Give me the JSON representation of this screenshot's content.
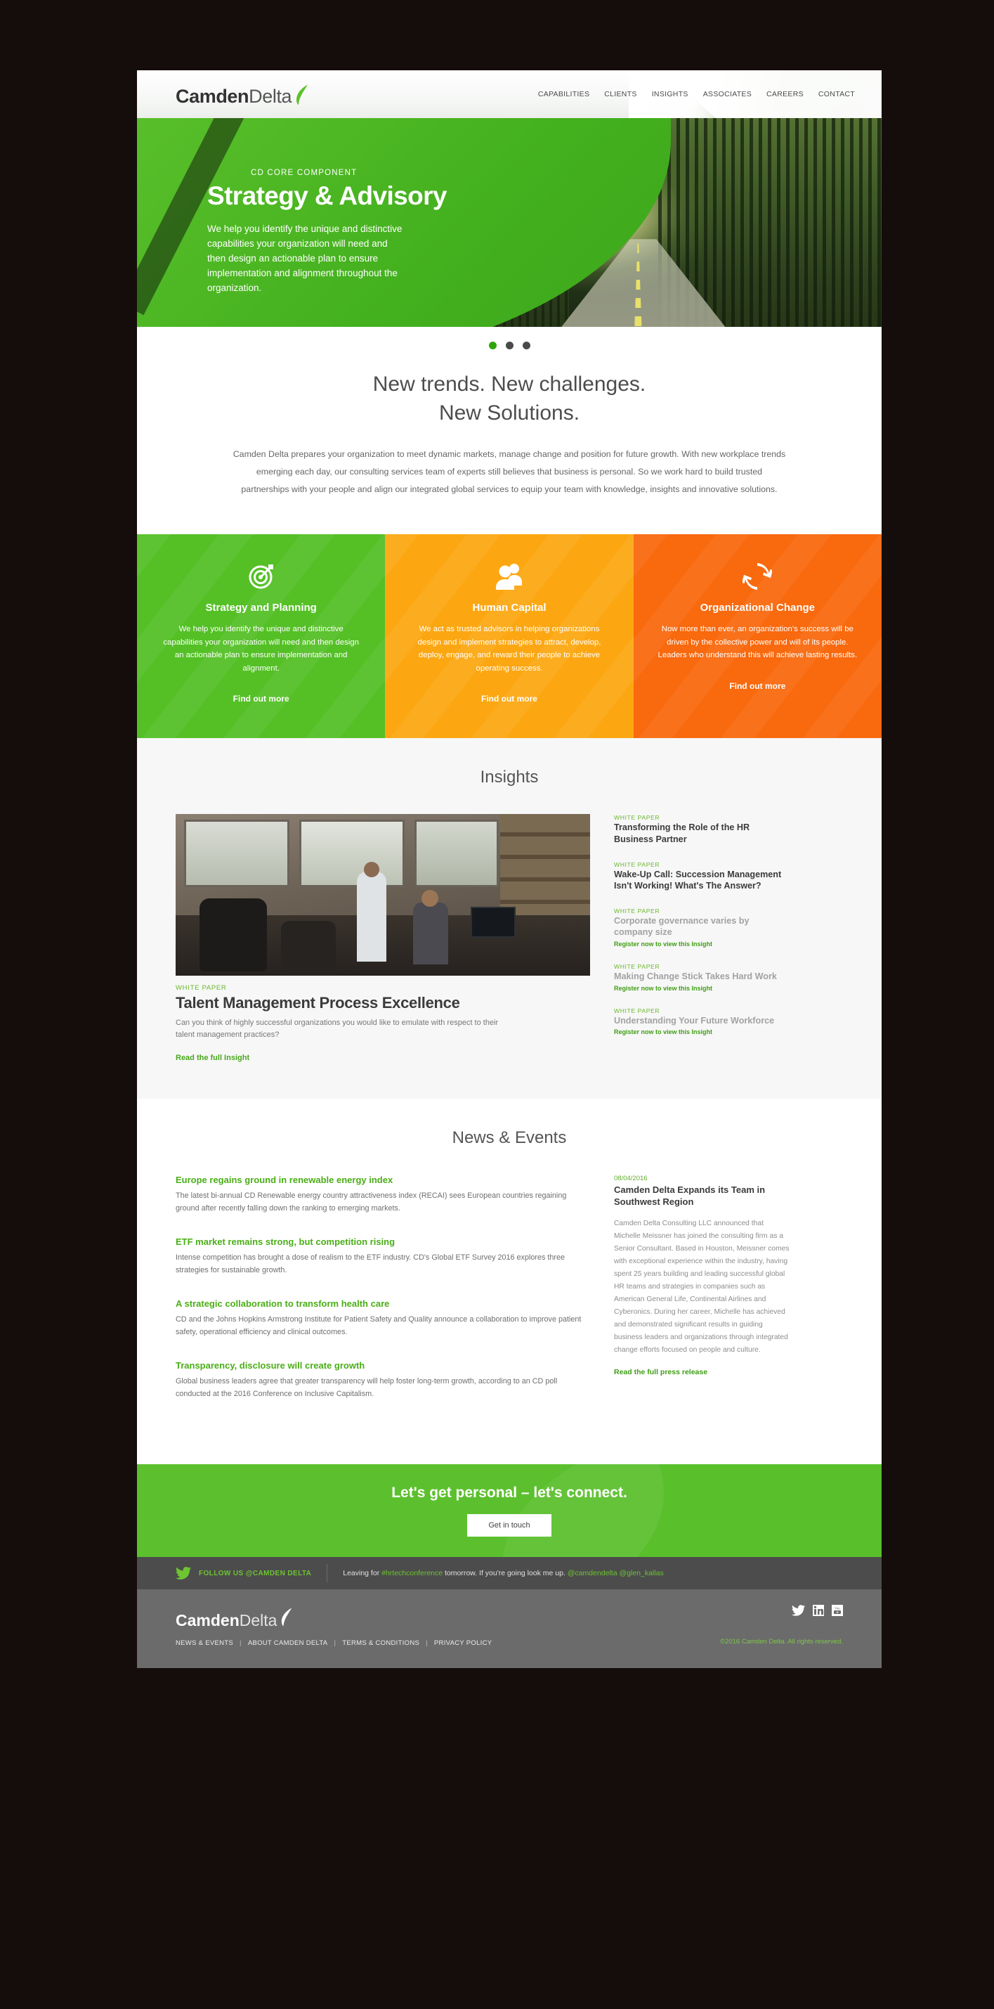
{
  "header": {
    "logo_primary": "Camden",
    "logo_secondary": "Delta",
    "nav": [
      {
        "label": "CAPABILITIES"
      },
      {
        "label": "CLIENTS"
      },
      {
        "label": "INSIGHTS"
      },
      {
        "label": "ASSOCIATES"
      },
      {
        "label": "CAREERS"
      },
      {
        "label": "CONTACT"
      }
    ]
  },
  "hero": {
    "kicker": "CD CORE COMPONENT",
    "title": "Strategy & Advisory",
    "copy": "We help you identify the unique and distinctive capabilities your organization will need and then design an actionable plan to ensure implementation and alignment throughout the organization.",
    "slides": 3,
    "active_slide": 1
  },
  "intro": {
    "heading_line1": "New trends. New challenges.",
    "heading_line2": "New Solutions.",
    "paragraph": "Camden Delta prepares your organization to meet dynamic markets, manage change and position for future growth.  With new workplace trends emerging each day, our consulting services team of experts still believes that business is personal. So we work hard to build trusted partnerships with your people and align our integrated global services to equip your team with knowledge, insights and innovative solutions."
  },
  "cards": [
    {
      "icon": "target-icon",
      "title": "Strategy and Planning",
      "copy": "We help you identify the unique and distinctive capabilities your organization will need and then design an actionable plan to ensure implementation and alignment.",
      "cta": "Find out more",
      "color": "#54c026"
    },
    {
      "icon": "people-icon",
      "title": "Human Capital",
      "copy": "We act as trusted advisors in helping organizations design and implement strategies to attract, develop, deploy, engage, and reward their people to achieve operating success.",
      "cta": "Find out more",
      "color": "#fca712"
    },
    {
      "icon": "refresh-cycle-icon",
      "title": "Organizational Change",
      "copy": "Now more than ever, an organization's success will be driven by the collective power and will of its people. Leaders who understand this will achieve lasting results.",
      "cta": "Find out more",
      "color": "#f9690e"
    }
  ],
  "insights": {
    "section_title": "Insights",
    "featured": {
      "label": "WHITE PAPER",
      "title": "Talent Management Process Excellence",
      "copy": "Can you think of highly successful organizations you would like to emulate with respect to their talent management practices?",
      "link": "Read the full Insight"
    },
    "side": [
      {
        "label": "WHITE PAPER",
        "title": "Transforming the Role of the HR Business Partner",
        "register": "",
        "muted": false
      },
      {
        "label": "WHITE PAPER",
        "title": "Wake-Up Call: Succession Management Isn't Working! What's The Answer?",
        "register": "",
        "muted": false
      },
      {
        "label": "WHITE PAPER",
        "title": "Corporate governance varies by company size",
        "register": "Register now to view this Insight",
        "muted": true
      },
      {
        "label": "WHITE PAPER",
        "title": "Making Change Stick Takes Hard Work",
        "register": "Register now to view this Insight",
        "muted": true
      },
      {
        "label": "WHITE PAPER",
        "title": "Understanding Your Future Workforce",
        "register": "Register now to view this Insight",
        "muted": true
      }
    ]
  },
  "news": {
    "section_title": "News & Events",
    "items": [
      {
        "title": "Europe regains ground in renewable energy index",
        "copy": "The latest bi-annual CD Renewable energy country attractiveness index (RECAI) sees European countries regaining ground after recently falling down the ranking to emerging markets."
      },
      {
        "title": "ETF market remains strong, but competition rising",
        "copy": "Intense competition has brought a dose of realism to the ETF industry. CD's Global ETF Survey 2016 explores three strategies for sustainable growth."
      },
      {
        "title": "A strategic collaboration to transform health care",
        "copy": "CD and the Johns Hopkins Armstrong Institute for Patient Safety and Quality announce a collaboration to improve patient safety, operational efficiency and clinical outcomes."
      },
      {
        "title": "Transparency, disclosure will create growth",
        "copy": "Global business leaders agree that greater transparency will help foster long-term growth, according to an CD poll conducted at the 2016 Conference on Inclusive Capitalism."
      }
    ],
    "press": {
      "date": "08/04/2016",
      "title": "Camden Delta Expands its Team in Southwest Region",
      "body": "Camden Delta Consulting LLC announced that Michelle Meissner has joined the consulting firm as a Senior Consultant. Based in Houston, Meissner comes with exceptional experience within the industry, having spent 25 years building and leading successful global HR teams and strategies in companies such as American General Life, Continental Airlines and Cyberonics. During her career, Michelle has achieved and demonstrated significant results in guiding business leaders and organizations through integrated change efforts focused on people and culture.",
      "link": "Read the full press release"
    }
  },
  "cta": {
    "title": "Let's get personal – let's connect.",
    "button": "Get in touch"
  },
  "twitter": {
    "follow": "FOLLOW US @CAMDEN DELTA",
    "tweet_part1": "Leaving for ",
    "tweet_hashtag": "#hrtechconference",
    "tweet_part2": " tomorrow. If you're going look me up. ",
    "tweet_mention1": "@camdendelta",
    "tweet_mention2": " @glen_kallas"
  },
  "footer": {
    "logo_primary": "Camden",
    "logo_secondary": "Delta",
    "links": [
      {
        "label": "NEWS & EVENTS"
      },
      {
        "label": "ABOUT CAMDEN DELTA"
      },
      {
        "label": "TERMS & CONDITIONS"
      },
      {
        "label": "PRIVACY POLICY"
      }
    ],
    "copyright": "©2016 Camden Delta. All rights reserved.",
    "social": [
      "twitter-icon",
      "linkedin-icon",
      "youtube-icon"
    ]
  }
}
